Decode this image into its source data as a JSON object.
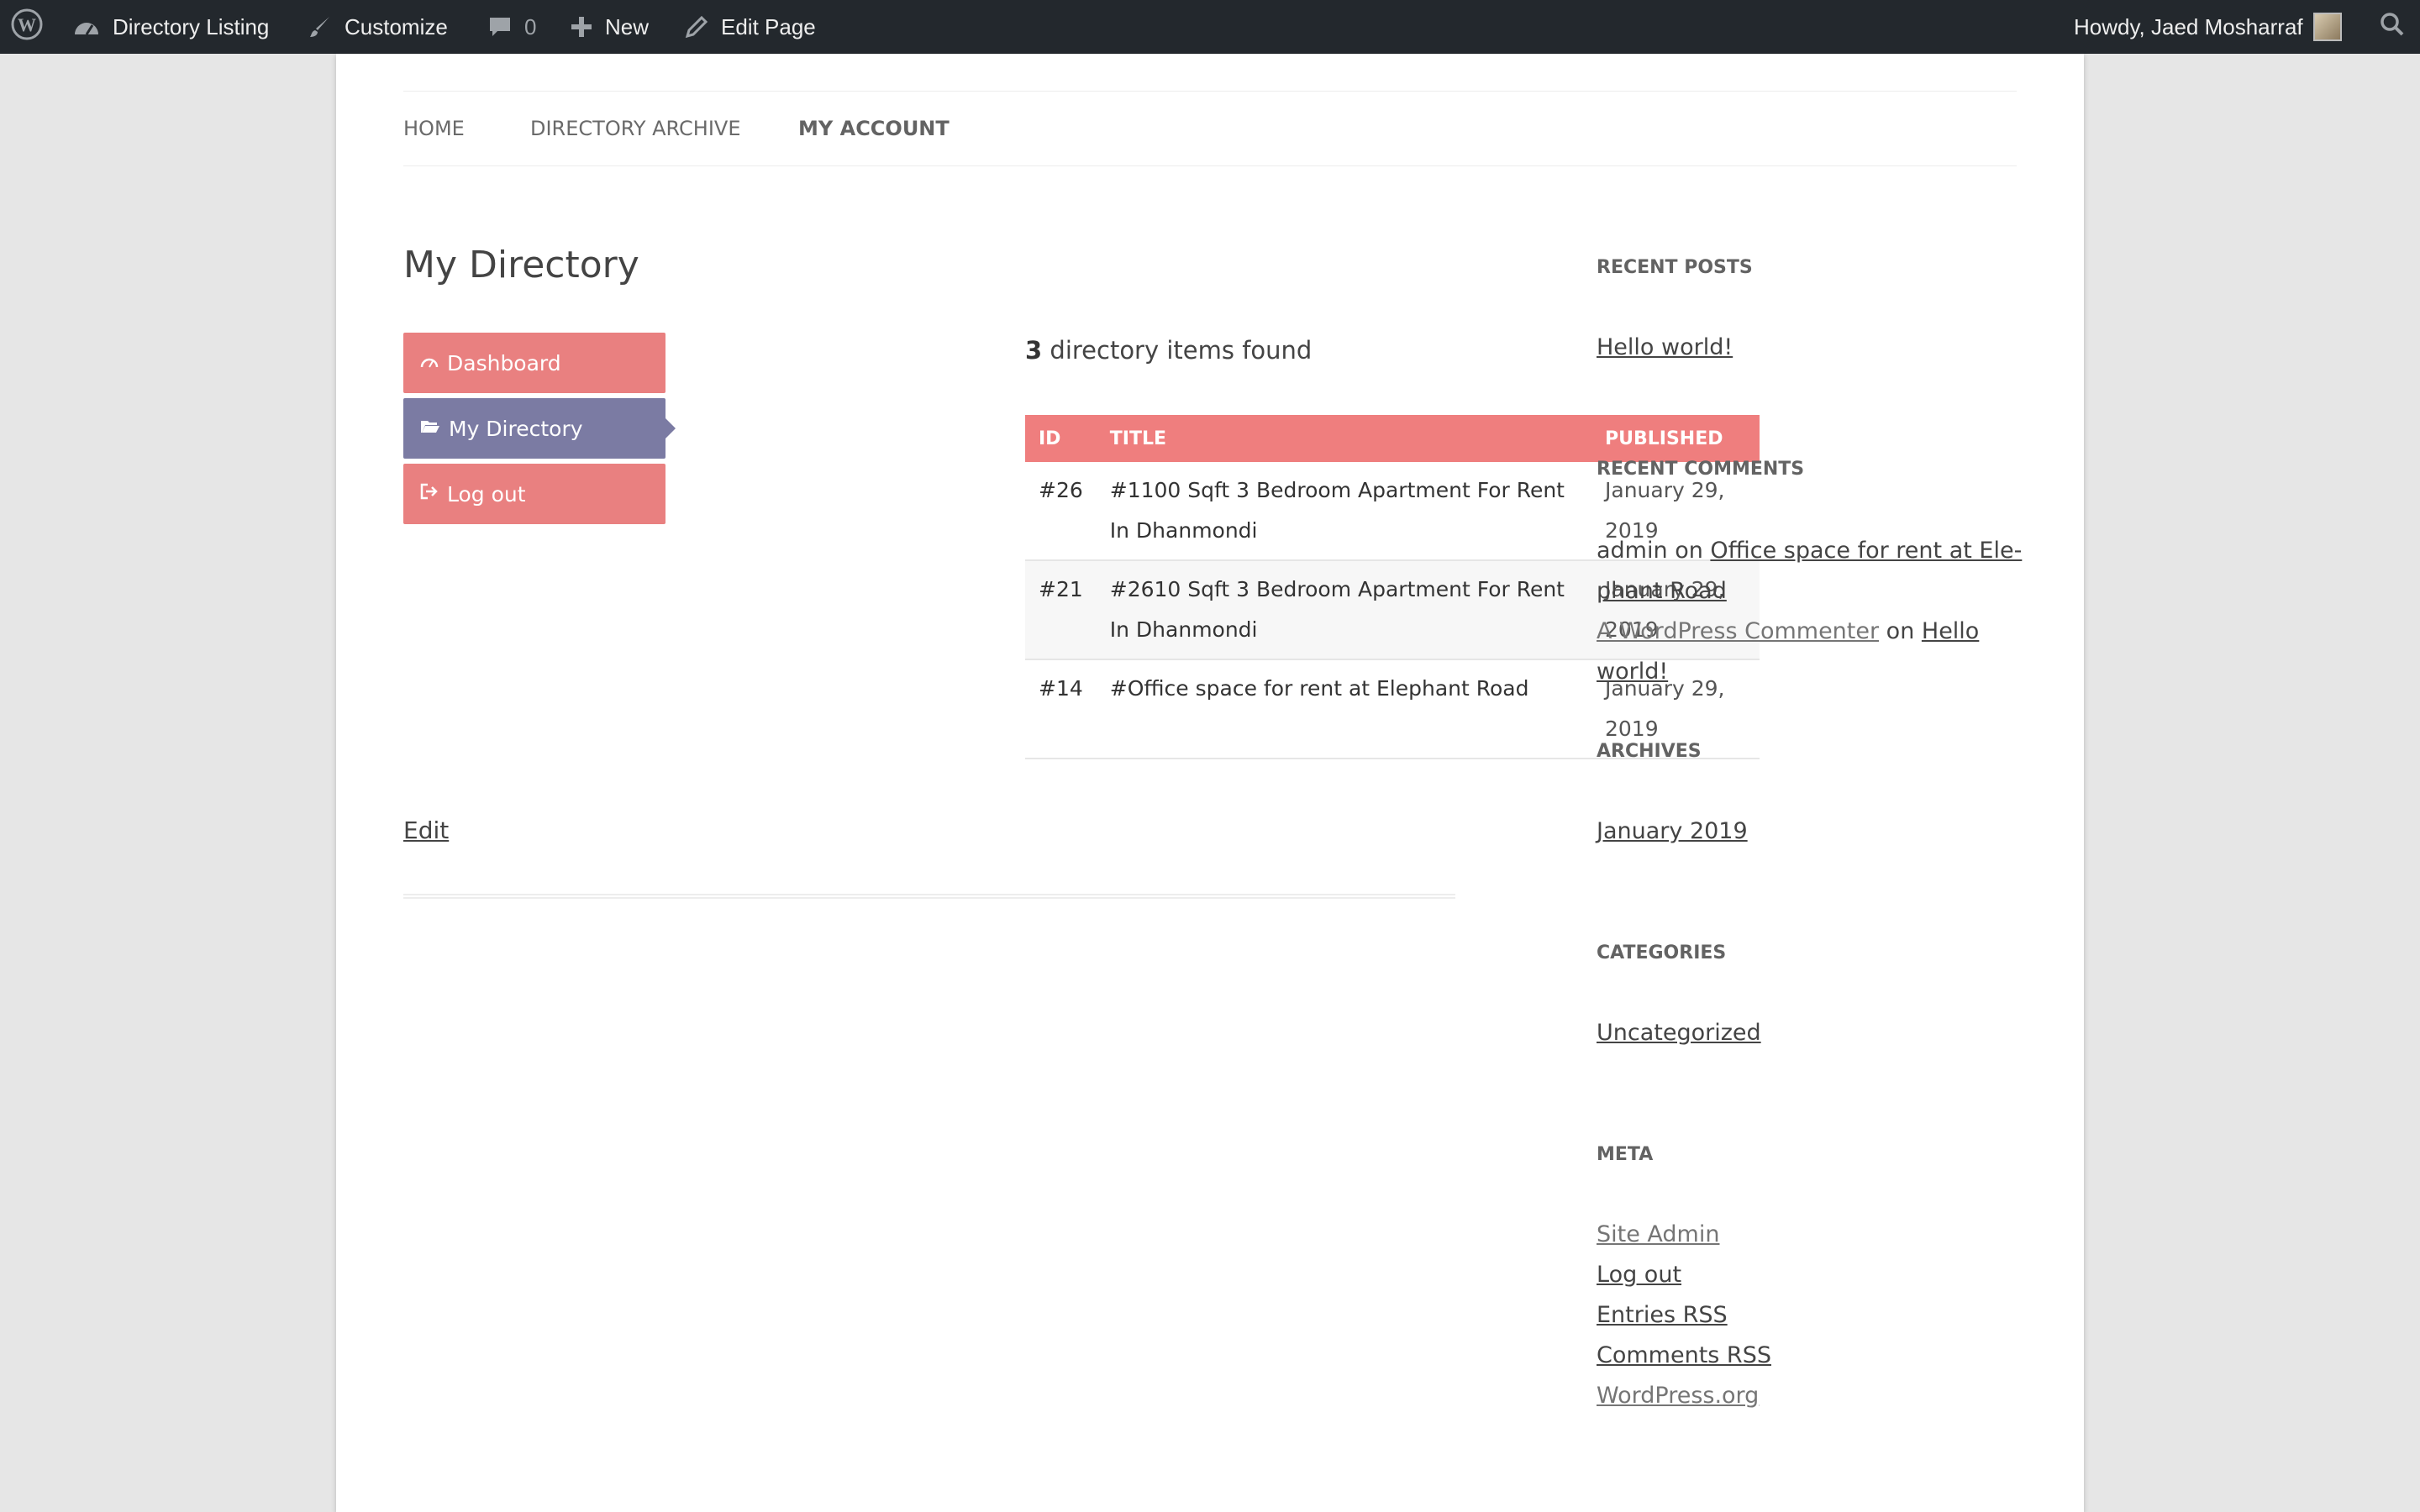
{
  "adminbar": {
    "site_name": "Directory Listing",
    "customize": "Customize",
    "comments_count": "0",
    "new": "New",
    "edit_page": "Edit Page",
    "howdy": "Howdy, Jaed Mosharraf"
  },
  "nav": {
    "items": [
      "HOME",
      "DIRECTORY ARCHIVE",
      "MY ACCOUNT"
    ],
    "active": "MY ACCOUNT"
  },
  "page_title": "My Directory",
  "dashboard_menu": [
    {
      "label": "Dashboard",
      "icon": "dashboard-icon",
      "active": false
    },
    {
      "label": "My Directory",
      "icon": "folder-open-icon",
      "active": true
    },
    {
      "label": "Log out",
      "icon": "logout-icon",
      "active": false
    }
  ],
  "found": {
    "count": "3",
    "text": " directory items found"
  },
  "table": {
    "headers": [
      "ID",
      "TITLE",
      "PUBLISHED"
    ],
    "rows": [
      {
        "id": "#26",
        "title": "#1100 Sqft 3 Bedroom Apartment For Rent In Dhanmondi",
        "published": "January 29, 2019"
      },
      {
        "id": "#21",
        "title": "#2610 Sqft 3 Bedroom Apartment For Rent In Dhanmondi",
        "published": "January 29, 2019"
      },
      {
        "id": "#14",
        "title": "#Office space for rent at Elephant Road",
        "published": "January 29, 2019"
      }
    ]
  },
  "edit_label": "Edit",
  "sidebar": {
    "recent_posts": {
      "title": "RECENT POSTS",
      "items": [
        "Hello world!"
      ]
    },
    "recent_comments": {
      "title": "RECENT COMMENTS",
      "c1_author": "admin",
      "c1_on": " on ",
      "c1_post_a": "Office space for rent at Ele-",
      "c1_post_b": "phant Road",
      "c2_author": "A WordPress Commenter",
      "c2_on": " on ",
      "c2_post": "Hello world!"
    },
    "archives": {
      "title": "ARCHIVES",
      "items": [
        "January 2019"
      ]
    },
    "categories": {
      "title": "CATEGORIES",
      "items": [
        "Uncategorized"
      ]
    },
    "meta": {
      "title": "META",
      "items": [
        "Site Admin",
        "Log out",
        "Entries RSS",
        "Comments RSS",
        "WordPress.org"
      ]
    }
  },
  "colors": {
    "accent": "#ef7e7e",
    "active_menu": "#7b7ba3",
    "adminbar": "#23282d"
  }
}
